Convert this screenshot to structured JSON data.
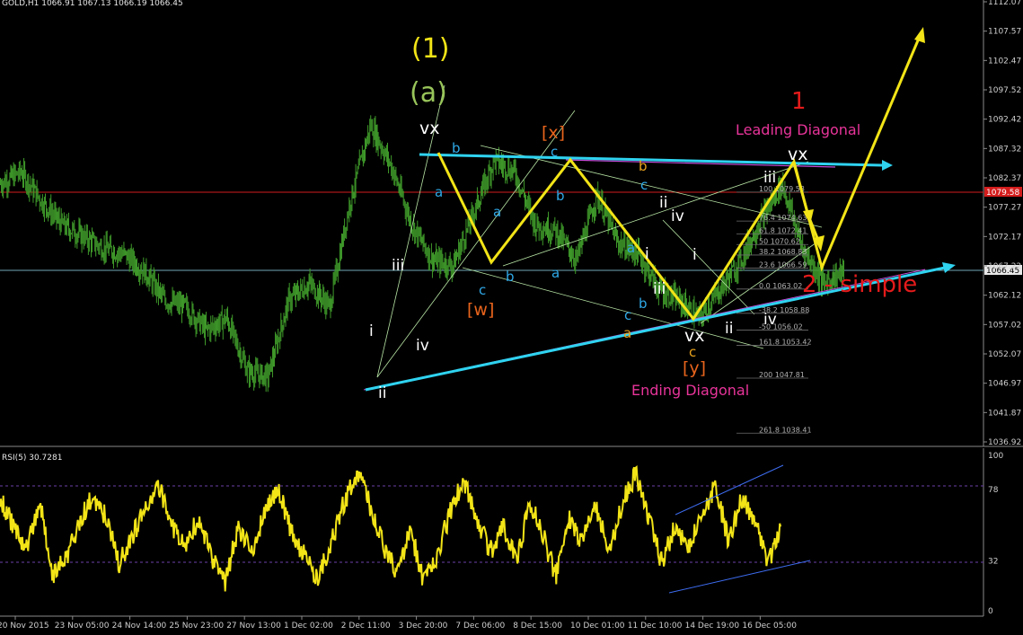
{
  "header": {
    "symbol_line": "GOLD,H1 1066.91 1067.13 1066.19 1066.45",
    "rsi_line": "RSI(5) 30.7281"
  },
  "colors": {
    "background": "#000000",
    "candles": "#3f9a2a",
    "wave_path": "#f2e417",
    "trendline": "#2fd3f0",
    "channel": "#b8e6a5",
    "resistance": "#d41c1c",
    "current_price": "#6fa9b4",
    "rsi_line": "#f2e417",
    "rsi_levels": "#6b3fa8",
    "leading_label": "#e8349a",
    "big_red": "#e51b1b"
  },
  "price_axis": {
    "ticks": [
      "1112.07",
      "1107.57",
      "1102.47",
      "1097.52",
      "1092.42",
      "1087.32",
      "1082.37",
      "1077.27",
      "1072.17",
      "1067.22",
      "1062.12",
      "1057.02",
      "1052.07",
      "1046.97",
      "1041.87",
      "1036.92"
    ],
    "resistance_label": "1079.58",
    "current_label": "1066.45"
  },
  "rsi_axis": {
    "ticks": [
      "100",
      "78",
      "32",
      "0"
    ]
  },
  "time_axis": {
    "ticks": [
      "20 Nov 2015",
      "23 Nov 05:00",
      "24 Nov 14:00",
      "25 Nov 23:00",
      "27 Nov 13:00",
      "1 Dec 02:00",
      "2 Dec 11:00",
      "3 Dec 20:00",
      "7 Dec 06:00",
      "8 Dec 15:00",
      "10 Dec 01:00",
      "11 Dec 10:00",
      "14 Dec 19:00",
      "16 Dec 05:00"
    ]
  },
  "fib_levels": [
    {
      "label": "100 1079.58"
    },
    {
      "label": "76.4 1074.63"
    },
    {
      "label": "61.8 1072.41"
    },
    {
      "label": "50 1070.62"
    },
    {
      "label": "38.2 1068.83"
    },
    {
      "label": "23.6 1066.59"
    },
    {
      "label": "0.0 1063.02"
    },
    {
      "label": "-38.2 1058.88"
    },
    {
      "label": "-50 1056.02"
    },
    {
      "label": "161.8 1053.42"
    },
    {
      "label": "200 1047.81"
    },
    {
      "label": "261.8 1038.41"
    }
  ],
  "annotations": {
    "wave1_yellow": "(1)",
    "wavea_green": "(a)",
    "vx_top": "vx",
    "x_bracket": "[x]",
    "w_bracket": "[w]",
    "y_bracket": "[y]",
    "vx_bottom": "vx",
    "vx_right": "vx",
    "one_red": "1",
    "leading_diagonal": "Leading Diagonal",
    "ending_diagonal": "Ending Diagonal",
    "two_simple": "2 - simple",
    "i_left": "i",
    "ii_left": "ii",
    "iii_left": "iii",
    "iv_left": "iv",
    "a_blue1": "a",
    "b_blue1": "b",
    "c_blue1": "c",
    "a_blue2": "a",
    "b_blue2": "b",
    "c_blue2": "c",
    "a_blue3": "a",
    "b_blue3": "b",
    "c_blue3": "c",
    "a_blue4": "a",
    "b_blue4": "b",
    "c_blue4": "c",
    "b_orange": "b",
    "a_orange": "a",
    "c_orange": "c",
    "i_mid": "i",
    "ii_mid": "ii",
    "iii_mid": "iii",
    "iv_mid": "iv",
    "i_right": "i",
    "ii_right": "ii",
    "iii_right": "iii",
    "iv_right": "iv"
  },
  "chart_data": [
    {
      "type": "candlestick",
      "title": "GOLD,H1",
      "ohlc_last": {
        "open": 1066.91,
        "high": 1067.13,
        "low": 1066.19,
        "close": 1066.45
      },
      "ylim": [
        1036.92,
        1112.07
      ],
      "xlabel": "",
      "ylabel": "",
      "categories": [
        "20 Nov 2015",
        "23 Nov 05:00",
        "24 Nov 14:00",
        "25 Nov 23:00",
        "27 Nov 13:00",
        "1 Dec 02:00",
        "2 Dec 11:00",
        "3 Dec 20:00",
        "7 Dec 06:00",
        "8 Dec 15:00",
        "10 Dec 01:00",
        "11 Dec 10:00",
        "14 Dec 19:00",
        "16 Dec 05:00"
      ],
      "series": [
        {
          "name": "",
          "values": [
            1081,
            1083,
            1078,
            1074,
            1072,
            1070,
            1069,
            1066,
            1061,
            1060,
            1056,
            1058,
            1049,
            1048,
            1061,
            1064,
            1060,
            1078,
            1091,
            1084,
            1074,
            1068,
            1067,
            1076,
            1085,
            1083,
            1074,
            1073,
            1068,
            1079,
            1071,
            1069,
            1063,
            1061,
            1058,
            1063,
            1068,
            1075,
            1081,
            1070,
            1064,
            1066
          ]
        }
      ],
      "levels": {
        "resistance": 1079.58,
        "current": 1066.45
      }
    },
    {
      "type": "line",
      "title": "RSI(5) 30.7281",
      "ylim": [
        0,
        100
      ],
      "levels": [
        78,
        32
      ],
      "series": [
        {
          "name": "",
          "values": [
            72,
            55,
            40,
            70,
            22,
            34,
            58,
            74,
            60,
            30,
            48,
            68,
            80,
            55,
            42,
            60,
            35,
            18,
            54,
            38,
            62,
            78,
            50,
            36,
            20,
            44,
            70,
            90,
            66,
            40,
            24,
            52,
            18,
            35,
            64,
            84,
            60,
            38,
            55,
            30,
            70,
            48,
            22,
            60,
            44,
            68,
            36,
            70,
            88,
            60,
            30,
            55,
            40,
            62,
            80,
            46,
            72,
            58,
            30,
            52
          ]
        }
      ]
    }
  ]
}
